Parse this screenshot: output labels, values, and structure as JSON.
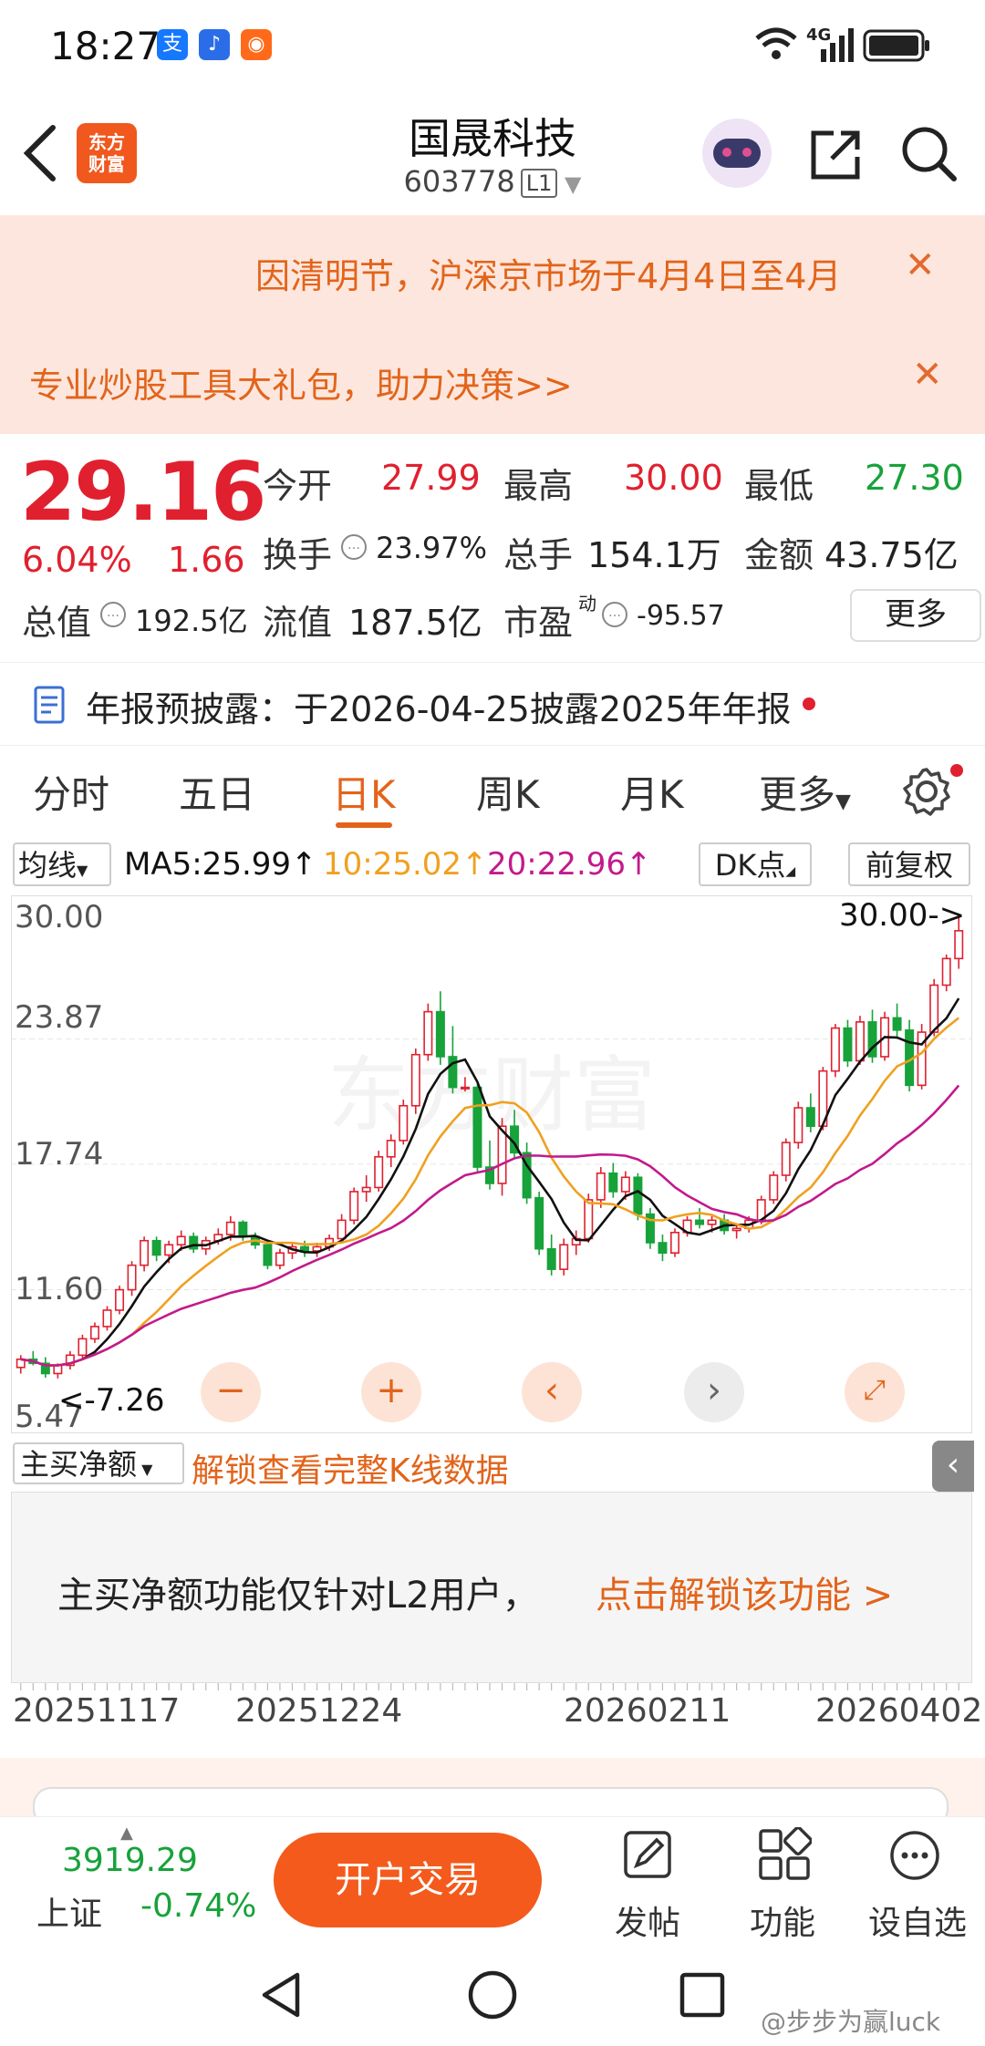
{
  "status": {
    "time": "18:27",
    "network": "4G"
  },
  "header": {
    "title": "国晟科技",
    "code": "603778",
    "level": "L1",
    "logo_text": "东方财富"
  },
  "notices": [
    {
      "text": "因清明节，沪深京市场于4月4日至4月"
    },
    {
      "text": "专业炒股工具大礼包，助力决策>>"
    }
  ],
  "quote": {
    "price": "29.16",
    "change_pct": "6.04%",
    "change": "1.66",
    "open_label": "今开",
    "open": "27.99",
    "high_label": "最高",
    "high": "30.00",
    "low_label": "最低",
    "low": "27.30",
    "turnover_label": "换手",
    "turnover": "23.97%",
    "volume_label": "总手",
    "volume": "154.1万",
    "amount_label": "金额",
    "amount": "43.75亿",
    "mktcap_label": "总值",
    "mktcap": "192.5亿",
    "float_label": "流值",
    "float": "187.5亿",
    "pe_label": "市盈",
    "pe_sup": "动",
    "pe": "-95.57",
    "more": "更多"
  },
  "report": {
    "text": "年报预披露：于2026-04-25披露2025年年报"
  },
  "tabs": [
    "分时",
    "五日",
    "日K",
    "周K",
    "月K",
    "更多"
  ],
  "active_tab": 2,
  "ma": {
    "selector": "均线",
    "ma5": "MA5:25.99↑",
    "ma10": "10:25.02↑",
    "ma20": "20:22.96↑",
    "dk": "DK点",
    "adjust": "前复权"
  },
  "chart_data": {
    "type": "candlestick",
    "y_ticks": [
      "30.00",
      "23.87",
      "17.74",
      "11.60",
      "5.47"
    ],
    "ylim": [
      5.47,
      30.0
    ],
    "max_label": "30.00->",
    "min_label": "<-7.26",
    "x_labels": [
      "20251117",
      "20251224",
      "20260211",
      "20260402"
    ],
    "candles": [
      [
        7.8,
        8.4,
        7.5,
        8.2
      ],
      [
        8.2,
        8.6,
        7.9,
        8.0
      ],
      [
        8.0,
        8.3,
        7.3,
        7.5
      ],
      [
        7.5,
        8.0,
        7.26,
        7.9
      ],
      [
        7.9,
        8.6,
        7.7,
        8.4
      ],
      [
        8.4,
        9.4,
        8.2,
        9.2
      ],
      [
        9.2,
        10.0,
        9.0,
        9.8
      ],
      [
        9.8,
        10.8,
        9.6,
        10.6
      ],
      [
        10.6,
        11.8,
        10.4,
        11.6
      ],
      [
        11.6,
        13.0,
        11.3,
        12.8
      ],
      [
        12.8,
        14.2,
        12.5,
        14.0
      ],
      [
        14.0,
        14.2,
        13.0,
        13.3
      ],
      [
        13.3,
        14.0,
        12.9,
        13.8
      ],
      [
        13.8,
        14.5,
        13.5,
        14.2
      ],
      [
        14.2,
        14.4,
        13.4,
        13.6
      ],
      [
        13.6,
        14.2,
        13.3,
        14.0
      ],
      [
        14.0,
        14.6,
        13.8,
        14.3
      ],
      [
        14.3,
        15.2,
        14.0,
        14.9
      ],
      [
        14.9,
        15.0,
        14.0,
        14.2
      ],
      [
        14.2,
        14.4,
        13.6,
        13.8
      ],
      [
        13.8,
        14.0,
        12.6,
        12.8
      ],
      [
        12.8,
        13.6,
        12.6,
        13.4
      ],
      [
        13.4,
        13.9,
        13.1,
        13.7
      ],
      [
        13.7,
        14.0,
        13.2,
        13.5
      ],
      [
        13.5,
        13.9,
        13.2,
        13.7
      ],
      [
        13.7,
        14.3,
        13.5,
        14.1
      ],
      [
        14.1,
        15.3,
        13.9,
        15.0
      ],
      [
        15.0,
        16.6,
        14.8,
        16.4
      ],
      [
        16.4,
        17.2,
        15.9,
        16.6
      ],
      [
        16.6,
        18.4,
        16.4,
        18.1
      ],
      [
        18.1,
        19.2,
        17.6,
        18.9
      ],
      [
        18.9,
        20.9,
        18.7,
        20.6
      ],
      [
        20.6,
        23.4,
        20.2,
        23.1
      ],
      [
        23.1,
        25.6,
        22.8,
        25.2
      ],
      [
        25.2,
        26.2,
        22.6,
        23.0
      ],
      [
        23.0,
        24.5,
        21.2,
        21.5
      ],
      [
        21.5,
        22.0,
        21.3,
        21.5
      ],
      [
        21.5,
        21.8,
        17.3,
        17.6
      ],
      [
        17.6,
        18.9,
        16.5,
        16.8
      ],
      [
        16.8,
        20.0,
        16.2,
        19.6
      ],
      [
        19.6,
        20.4,
        18.0,
        18.3
      ],
      [
        18.3,
        18.8,
        15.8,
        16.1
      ],
      [
        16.1,
        16.4,
        13.3,
        13.6
      ],
      [
        13.6,
        14.3,
        12.3,
        12.6
      ],
      [
        12.6,
        14.1,
        12.3,
        13.8
      ],
      [
        13.8,
        14.5,
        13.3,
        14.1
      ],
      [
        14.1,
        16.3,
        13.9,
        16.0
      ],
      [
        16.0,
        17.6,
        15.6,
        17.3
      ],
      [
        17.3,
        17.8,
        16.1,
        16.4
      ],
      [
        16.4,
        17.4,
        16.0,
        17.1
      ],
      [
        17.1,
        17.3,
        15.0,
        15.3
      ],
      [
        15.3,
        15.6,
        13.6,
        13.9
      ],
      [
        13.9,
        14.3,
        13.0,
        13.4
      ],
      [
        13.4,
        14.6,
        13.2,
        14.4
      ],
      [
        14.4,
        15.2,
        14.2,
        15.0
      ],
      [
        15.0,
        15.6,
        14.6,
        14.8
      ],
      [
        14.8,
        15.2,
        14.4,
        15.0
      ],
      [
        15.0,
        15.3,
        14.3,
        14.5
      ],
      [
        14.5,
        14.8,
        14.1,
        14.6
      ],
      [
        14.6,
        15.2,
        14.4,
        15.0
      ],
      [
        15.0,
        16.2,
        14.8,
        16.0
      ],
      [
        16.0,
        17.4,
        15.8,
        17.2
      ],
      [
        17.2,
        19.0,
        16.9,
        18.8
      ],
      [
        18.8,
        20.8,
        18.5,
        20.5
      ],
      [
        20.5,
        21.2,
        19.3,
        19.6
      ],
      [
        19.6,
        22.5,
        19.4,
        22.3
      ],
      [
        22.3,
        24.6,
        22.0,
        24.4
      ],
      [
        24.4,
        24.8,
        22.5,
        22.8
      ],
      [
        22.8,
        25.0,
        22.6,
        24.7
      ],
      [
        24.7,
        25.3,
        22.7,
        23.0
      ],
      [
        23.0,
        25.2,
        22.8,
        24.9
      ],
      [
        24.9,
        25.6,
        24.0,
        24.3
      ],
      [
        24.3,
        24.8,
        21.3,
        21.6
      ],
      [
        21.6,
        24.6,
        21.4,
        24.2
      ],
      [
        24.2,
        26.8,
        24.0,
        26.5
      ],
      [
        26.5,
        28.0,
        26.2,
        27.8
      ],
      [
        27.8,
        30.0,
        27.3,
        29.16
      ]
    ],
    "ma_series": [
      {
        "name": "MA5",
        "color": "#111111"
      },
      {
        "name": "MA10",
        "color": "#f0a020"
      },
      {
        "name": "MA20",
        "color": "#c21a8c"
      }
    ]
  },
  "indicator": {
    "selector": "主买净额",
    "unlock_link": "解锁查看完整K线数据",
    "message": "主买净额功能仅针对L2用户，",
    "cta": "点击解锁该功能 >"
  },
  "bottom": {
    "index_value": "3919.29",
    "index_name": "上证",
    "index_change": "-0.74%",
    "trade_button": "开户交易",
    "post": "发帖",
    "functions": "功能",
    "watchlist": "设自选"
  },
  "watermark": "@步步为赢luck"
}
